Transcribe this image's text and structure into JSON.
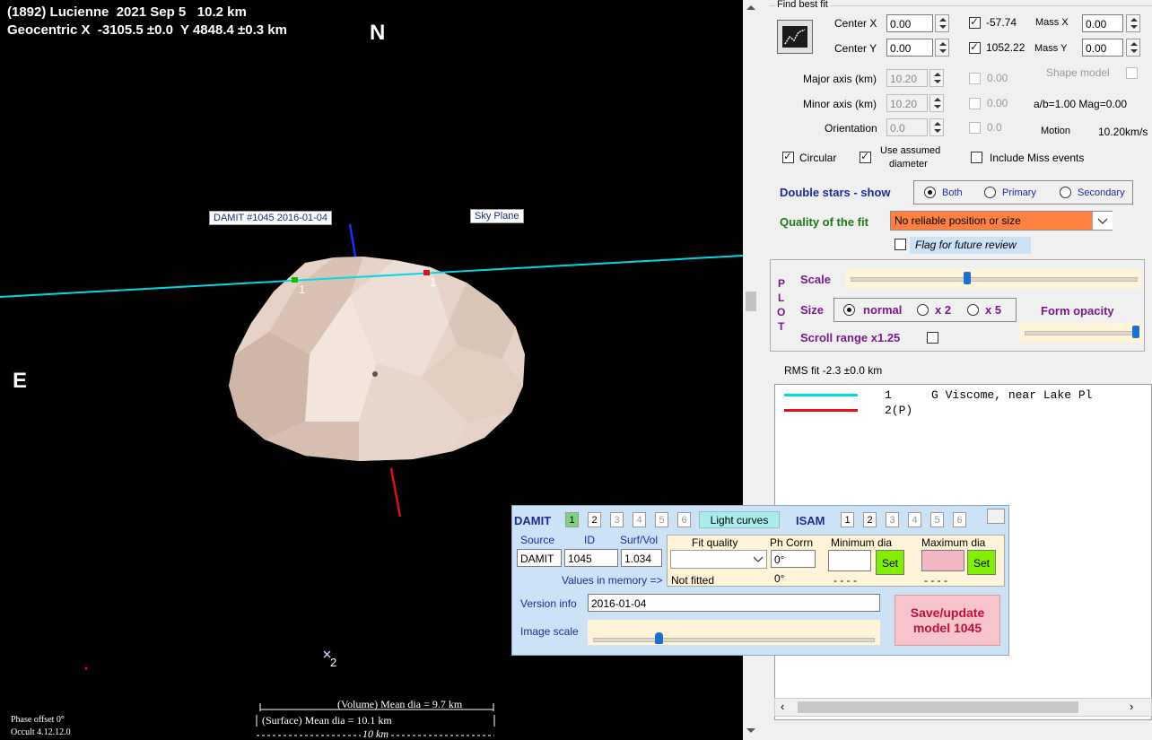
{
  "plot": {
    "header_line1": "(1892) Lucienne  2021 Sep 5   10.2 km",
    "header_line2": "Geocentric X  -3105.5 ±0.0  Y 4848.4 ±0.3 km",
    "north": "N",
    "east": "E",
    "damit_label": "DAMIT #1045 2016-01-04",
    "sky_plane_label": "Sky Plane",
    "chord1_label_a": "1",
    "chord1_label_b": "1",
    "chord2_label": "2",
    "volume_dia": "(Volume) Mean dia = 9.7 km",
    "surface_dia": "(Surface) Mean dia = 10.1 km",
    "scale_bar": "10 km",
    "phase_offset": "Phase offset 0°",
    "version": "Occult 4.12.12.0",
    "colors": {
      "chord1": "#00d8e8",
      "chord2": "#ff1a1a",
      "axis": "#1a2dff",
      "body": "#e8d4c8"
    }
  },
  "fit": {
    "title": "Find best fit",
    "center_x_label": "Center X",
    "center_x": "0.00",
    "center_y_label": "Center Y",
    "center_y": "0.00",
    "cx_value": "-57.74",
    "cy_value": "1052.22",
    "mass_x_label": "Mass X",
    "mass_x": "0.00",
    "mass_y_label": "Mass Y",
    "mass_y": "0.00",
    "major_label": "Major axis (km)",
    "major": "10.20",
    "minor_label": "Minor axis (km)",
    "minor": "10.20",
    "orient_label": "Orientation",
    "orient": "0.0",
    "major_chk_val": "0.00",
    "minor_chk_val": "0.00",
    "orient_chk_val": "0.0",
    "shape_model": "Shape model",
    "ab_mag": "a/b=1.00  Mag=0.00",
    "motion_label": "Motion",
    "motion": "10.20km/s",
    "circular": "Circular",
    "use_assumed_1": "Use assumed",
    "use_assumed_2": "diameter",
    "include_miss": "Include Miss events"
  },
  "double_stars": {
    "label": "Double stars - show",
    "both": "Both",
    "primary": "Primary",
    "secondary": "Secondary"
  },
  "quality": {
    "label": "Quality of the fit",
    "value": "No reliable position or size",
    "flag": "Flag for future review"
  },
  "plot_ctrl": {
    "p": "P",
    "l": "L",
    "o": "O",
    "t": "T",
    "scale": "Scale",
    "size": "Size",
    "normal": "normal",
    "x2": "x 2",
    "x5": "x 5",
    "opacity": "Form opacity",
    "scroll_range": "Scroll range x1.25",
    "scale_level": 0.4,
    "opacity_level": 0.97
  },
  "rms": "RMS fit -2.3 ±0.0 km",
  "observers": [
    {
      "num": "1",
      "name": "G Viscome, near Lake Pl",
      "color": "#00d8e8"
    },
    {
      "num": "2(P)",
      "name": "",
      "color": "#e01010"
    }
  ],
  "damit": {
    "title": "DAMIT",
    "nums": [
      "1",
      "2",
      "3",
      "4",
      "5",
      "6"
    ],
    "light_curves": "Light curves",
    "isam": "ISAM",
    "isam_nums": [
      "1",
      "2",
      "3",
      "4",
      "5",
      "6"
    ],
    "source_label": "Source",
    "id_label": "ID",
    "surfvol_label": "Surf/Vol",
    "source": "DAMIT",
    "id": "1045",
    "surfvol": "1.034",
    "values_in_memory": "Values in memory =>",
    "fit_quality_label": "Fit quality",
    "ph_corrn_label": "Ph Corrn",
    "min_dia_label": "Minimum dia",
    "max_dia_label": "Maximum dia",
    "ph_corrn": "0°",
    "not_fitted": "Not fitted",
    "ph_mem": "0°",
    "min_mem": "- - - -",
    "max_mem": "- - - -",
    "set": "Set",
    "version_label": "Version info",
    "version": "2016-01-04",
    "image_scale_label": "Image scale",
    "save_line1": "Save/update",
    "save_line2": "model 1045",
    "image_scale_level": 0.22
  }
}
